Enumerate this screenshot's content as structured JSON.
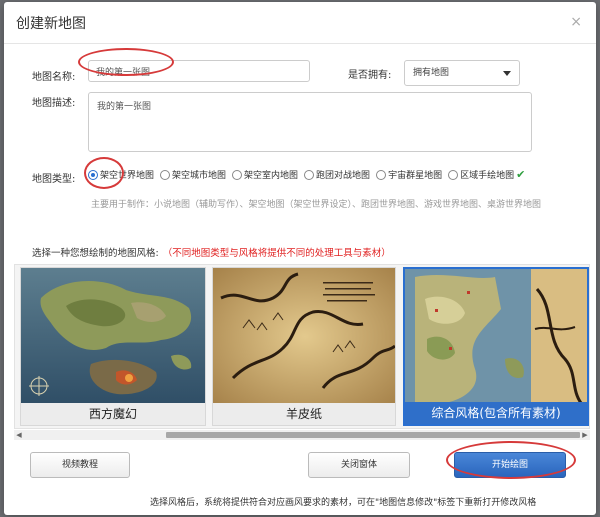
{
  "dialog": {
    "title": "创建新地图",
    "close_glyph": "×"
  },
  "form": {
    "name_label": "地图名称:",
    "name_value": "我的第一张图",
    "own_label": "是否拥有:",
    "own_selected": "拥有地图",
    "desc_label": "地图描述:",
    "desc_value": "我的第一张图",
    "type_label": "地图类型:",
    "types": [
      {
        "label": "架空世界地图",
        "checked": true
      },
      {
        "label": "架空城市地图",
        "checked": false
      },
      {
        "label": "架空室内地图",
        "checked": false
      },
      {
        "label": "跑团对战地图",
        "checked": false
      },
      {
        "label": "宇宙群星地图",
        "checked": false
      },
      {
        "label": "区域手绘地图",
        "checked": false
      }
    ],
    "usage_note": "主要用于制作：小说地图（辅助写作）、架空地图（架空世界设定）、跑团世界地图、游戏世界地图、桌游世界地图"
  },
  "styles": {
    "prompt": "选择一种您想绘制的地图风格:",
    "warning": "（不同地图类型与风格将提供不同的处理工具与素材）",
    "cards": [
      {
        "caption": "西方魔幻",
        "selected": false
      },
      {
        "caption": "羊皮纸",
        "selected": false
      },
      {
        "caption": "综合风格(包含所有素材)",
        "selected": true
      }
    ]
  },
  "buttons": {
    "video": "视频教程",
    "close": "关闭窗体",
    "start": "开始绘图"
  },
  "footer_note": "选择风格后，系统将提供符合对应画风要求的素材，可在\"地图信息修改\"标签下重新打开修改风格",
  "colors": {
    "accent": "#2a6fd0",
    "warning": "#e02020",
    "annotation": "#d63a3a"
  }
}
